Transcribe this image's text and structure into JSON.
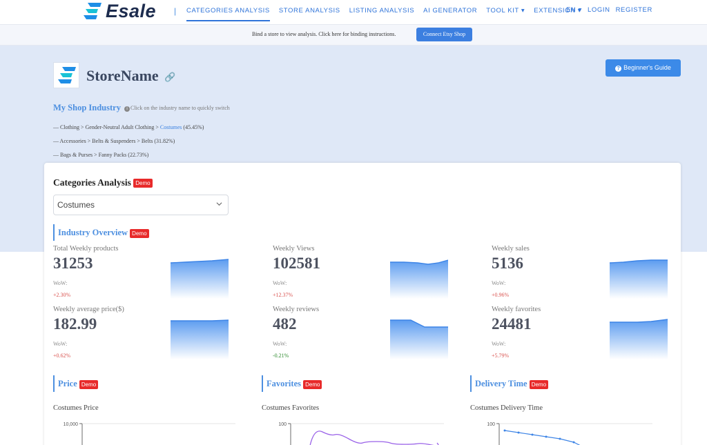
{
  "nav": {
    "logo_text": "Esale",
    "separator": "|",
    "links": [
      "CATEGORIES ANALYSIS",
      "STORE ANALYSIS",
      "LISTING ANALYSIS",
      "AI GENERATOR",
      "TOOL KIT ▾",
      "EXTENSION ▾"
    ],
    "lang": "EN ▾",
    "login": "LOGIN",
    "register": "REGISTER"
  },
  "bind_bar": {
    "text": "Bind a store to view analysis. Click here for binding instructions.",
    "button": "Connect Etsy Shop"
  },
  "store": {
    "name": "StoreName",
    "guide_button": "Beginner's Guide",
    "industry_title": "My Shop Industry",
    "industry_hint": "Click on the industry name to quickly switch",
    "industries": [
      {
        "path": "— Clothing > Gender-Neutral Adult Clothing > ",
        "highlight": "Costumes",
        "pct": " (45.45%)"
      },
      {
        "path": "— Accessories > Belts & Suspenders > Belts (31.82%)",
        "highlight": "",
        "pct": ""
      },
      {
        "path": "— Bags & Purses > Fanny Packs (22.73%)",
        "highlight": "",
        "pct": ""
      }
    ]
  },
  "categories": {
    "title": "Categories Analysis",
    "demo": "Demo",
    "selected": "Costumes",
    "overview_title": "Industry Overview"
  },
  "metrics": [
    {
      "label": "Total Weekly products",
      "value": "31253",
      "wow_label": "WoW:",
      "wow": "+2.30%",
      "trend": "up"
    },
    {
      "label": "Weekly Views",
      "value": "102581",
      "wow_label": "WoW:",
      "wow": "+12.37%",
      "trend": "up"
    },
    {
      "label": "Weekly sales",
      "value": "5136",
      "wow_label": "WoW:",
      "wow": "+0.96%",
      "trend": "up"
    },
    {
      "label": "Weekly average price($)",
      "value": "182.99",
      "wow_label": "WoW:",
      "wow": "+0.62%",
      "trend": "up"
    },
    {
      "label": "Weekly reviews",
      "value": "482",
      "wow_label": "WoW:",
      "wow": "-0.21%",
      "trend": "down"
    },
    {
      "label": "Weekly favorites",
      "value": "24481",
      "wow_label": "WoW:",
      "wow": "+5.79%",
      "trend": "up"
    }
  ],
  "sections": {
    "price": "Price",
    "favorites": "Favorites",
    "delivery": "Delivery Time"
  },
  "charts": {
    "price_title": "Costumes Price",
    "price_tick": "10,000",
    "favorites_title": "Costumes Favorites",
    "favorites_tick": "100",
    "delivery_title": "Costumes Delivery Time",
    "delivery_tick": "100"
  },
  "colors": {
    "accent": "#2e73d9",
    "demo": "#e82a2a",
    "spark_line": "#3d84e6",
    "fav_line": "#9a62e8",
    "delivery_line": "#3d84e6"
  }
}
